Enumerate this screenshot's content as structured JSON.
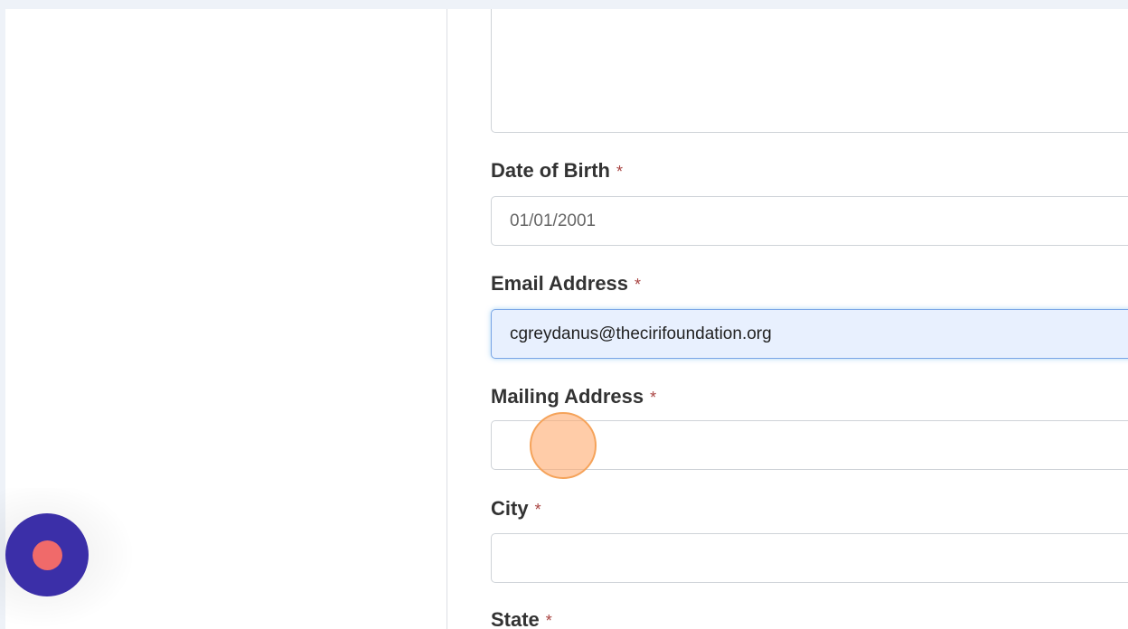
{
  "form": {
    "required_marker": "*",
    "date_of_birth": {
      "label": "Date of Birth",
      "value": "01/01/2001"
    },
    "email": {
      "label": "Email Address",
      "value": "cgreydanus@thecirifoundation.org"
    },
    "mailing_address": {
      "label": "Mailing Address",
      "value": ""
    },
    "city": {
      "label": "City",
      "value": ""
    },
    "state": {
      "label": "State"
    }
  },
  "colors": {
    "accent_fab": "#3b2fa8",
    "fab_dot": "#f06a6a",
    "required": "#a94442",
    "click_indicator": "#f5a35a"
  },
  "icons": {
    "fab": "record-icon"
  }
}
